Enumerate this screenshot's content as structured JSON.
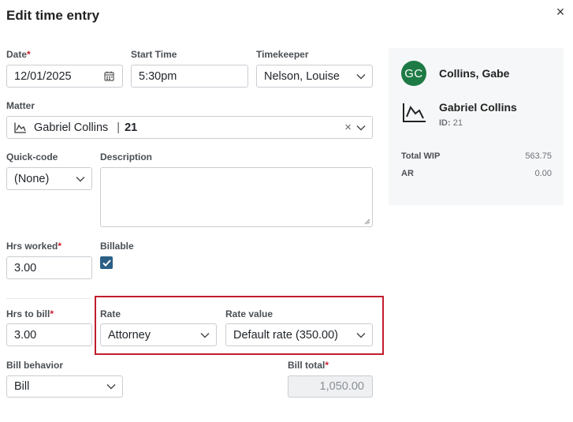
{
  "dialog": {
    "title": "Edit time entry",
    "close_glyph": "×"
  },
  "fields": {
    "date": {
      "label": "Date",
      "required_mark": "*",
      "value": "12/01/2025"
    },
    "start_time": {
      "label": "Start Time",
      "value": "5:30pm"
    },
    "timekeeper": {
      "label": "Timekeeper",
      "value": "Nelson, Louise"
    },
    "matter": {
      "label": "Matter",
      "name": "Gabriel Collins",
      "separator": "|",
      "id": "21",
      "clear_glyph": "×"
    },
    "quick_code": {
      "label": "Quick-code",
      "value": "(None)"
    },
    "description": {
      "label": "Description",
      "value": ""
    },
    "hrs_worked": {
      "label": "Hrs worked",
      "required_mark": "*",
      "value": "3.00"
    },
    "billable": {
      "label": "Billable",
      "checked": true
    },
    "hrs_to_bill": {
      "label": "Hrs to bill",
      "required_mark": "*",
      "value": "3.00"
    },
    "rate": {
      "label": "Rate",
      "value": "Attorney"
    },
    "rate_value": {
      "label": "Rate value",
      "value": "Default rate (350.00)"
    },
    "bill_behavior": {
      "label": "Bill behavior",
      "value": "Bill"
    },
    "bill_total": {
      "label": "Bill total",
      "required_mark": "*",
      "value": "1,050.00"
    }
  },
  "side_panel": {
    "avatar_initials": "GC",
    "person_name": "Collins, Gabe",
    "matter_name": "Gabriel Collins",
    "matter_id_label": "ID:",
    "matter_id": "21",
    "summary": [
      {
        "label": "Total WIP",
        "value": "563.75"
      },
      {
        "label": "AR",
        "value": "0.00"
      }
    ]
  },
  "colors": {
    "avatar": "#1e7a45",
    "checkbox": "#2b5f86",
    "highlight": "#c21d2d",
    "required": "#cc1f2f"
  }
}
